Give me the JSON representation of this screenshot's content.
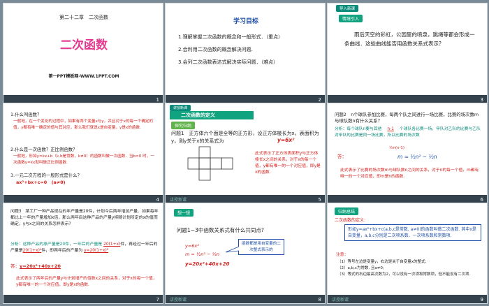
{
  "slides": [
    {
      "num": "1",
      "chapter": "第二十二章　二次函数",
      "title": "二次函数",
      "footer": "第一PPT模板网-WWW.1PPT.COM"
    },
    {
      "num": "2",
      "heading": "学习目标",
      "items": [
        "1.理解掌握二次函数的概念和一般形式．（重点）",
        "2.会利用二次函数的概念解决问题.",
        "3.会列二次函数表达式解决实际问题．（难点）"
      ]
    },
    {
      "num": "3",
      "badge": "导入新课",
      "btn": "情境引入",
      "text": "雨后天空的彩虹，公园里的喷泉，跳绳等都会形成一条曲线．这些曲线能否用函数关系式表示？"
    },
    {
      "num": "4",
      "q1": "1.什么叫函数？",
      "a1": "一般地，在一个变化的过程中，如果有两个变量x与y，并且对于x的每一个确定的值，y都有唯一确定的值与其对应，那么我们就说x是自变量，y是x的函数.",
      "q2": "2.什么是一次函数？正比例函数？",
      "a2": "一般地，形如y=kx+b（k,b是常数，k≠0）的函数叫做一次函数．当b=0 时，一次函数y=kx就叫做正比例函数.",
      "q3": "3.一元二次方程的一般形式是什么？",
      "a3": "ax²+bx+c=0　(a≠0)"
    },
    {
      "num": "5",
      "tag": "讲授新课",
      "badge": "讲授新课",
      "section": "二次函数的定义",
      "btn": "探究归纳",
      "q": "问题1　正方体六个面是全等的正方形，设正方体棱长为x，表面积为y，则y关于x的关系式为",
      "ans": "y=6x²",
      "note": "此式表示了正方体表面积y与正方体棱长x之间的关系，对于x的每一个值，y都有唯一的一个对应值，即y是x的函数."
    },
    {
      "num": "6",
      "q": "问题2　n个球队参加比赛，每两个队之间进行一场比赛，比赛的场次数m与球队数n有什么关系？",
      "analysis": "分析：每个球队n要与其他",
      "blank1": "n-1",
      "analysis2": "个球队各比赛一场，甲队对乙队的比赛与乙队对甲队的比赛是同一场比赛，所以比赛的场次数",
      "formula": "½n(n-1)",
      "ans_label": "答：",
      "ans": "m = ½n² − ½n",
      "note": "此式表示了比赛的场次数m与球队数n之间的关系，对于n的每一个值，m都有唯一的一个对应值，即m是n的函数."
    },
    {
      "num": "7",
      "q": "问题3　某工厂一种产品现在的年产量是20件，计划今后两年增加产量．如果每年都比上一年的产量增加x倍，那么两年后这种产品的产量y将随计划所定的x的值而确定，y与x之间的关系怎样表示？",
      "analysis": "分析：这种产品的原产量是20件，一年后的产量是",
      "blank1": "20(1+x)",
      "mid": "件，再经过一年后的产量是",
      "blank2": "20(1+x)²",
      "end": "件，即两年后的产量为",
      "blank3": "y=20(1+x)²",
      "ans_label": "答：",
      "ans": "y=20x²+40x+20",
      "note": "此式表示了两年后的产量y与计划增产的倍数x之间的关系，对于x的每一个值，y都有唯一的一个对应值，即y是x的函数."
    },
    {
      "num": "8",
      "tag": "讲授新课",
      "btn": "想一想",
      "q": "问题1~3中函数关系式有什么共同点?",
      "f1": "y=6x²",
      "f2": "m = ½n² − ½n",
      "f3": "y=20x²+40x+20",
      "callout": "函数都是用自变量的二次整式表示的"
    },
    {
      "num": "9",
      "tag": "讲授新课",
      "btn": "归纳总结",
      "sub": "二次函数的定义:",
      "def": "形如y=ax²+bx+c(a,b,c是常数, a≠0)的函数叫做二次函数. 其中x是自变量，a,b,c分别是二次项系数、一次项系数和常数项.",
      "notice": "注意：",
      "n1": "（1）等号左边是变量y，右边是关于自变量x的整式;",
      "n2": "（2）a,b,c为常数, 且a≠0;",
      "n3": "（3）等式的右边最高次数为2，可以没有一次项和常数项，但不能没有二次项."
    }
  ],
  "colors": {
    "accent": "#10a37f",
    "red": "#d3211d",
    "blue": "#1f4fa8",
    "dark": "#33424c"
  }
}
